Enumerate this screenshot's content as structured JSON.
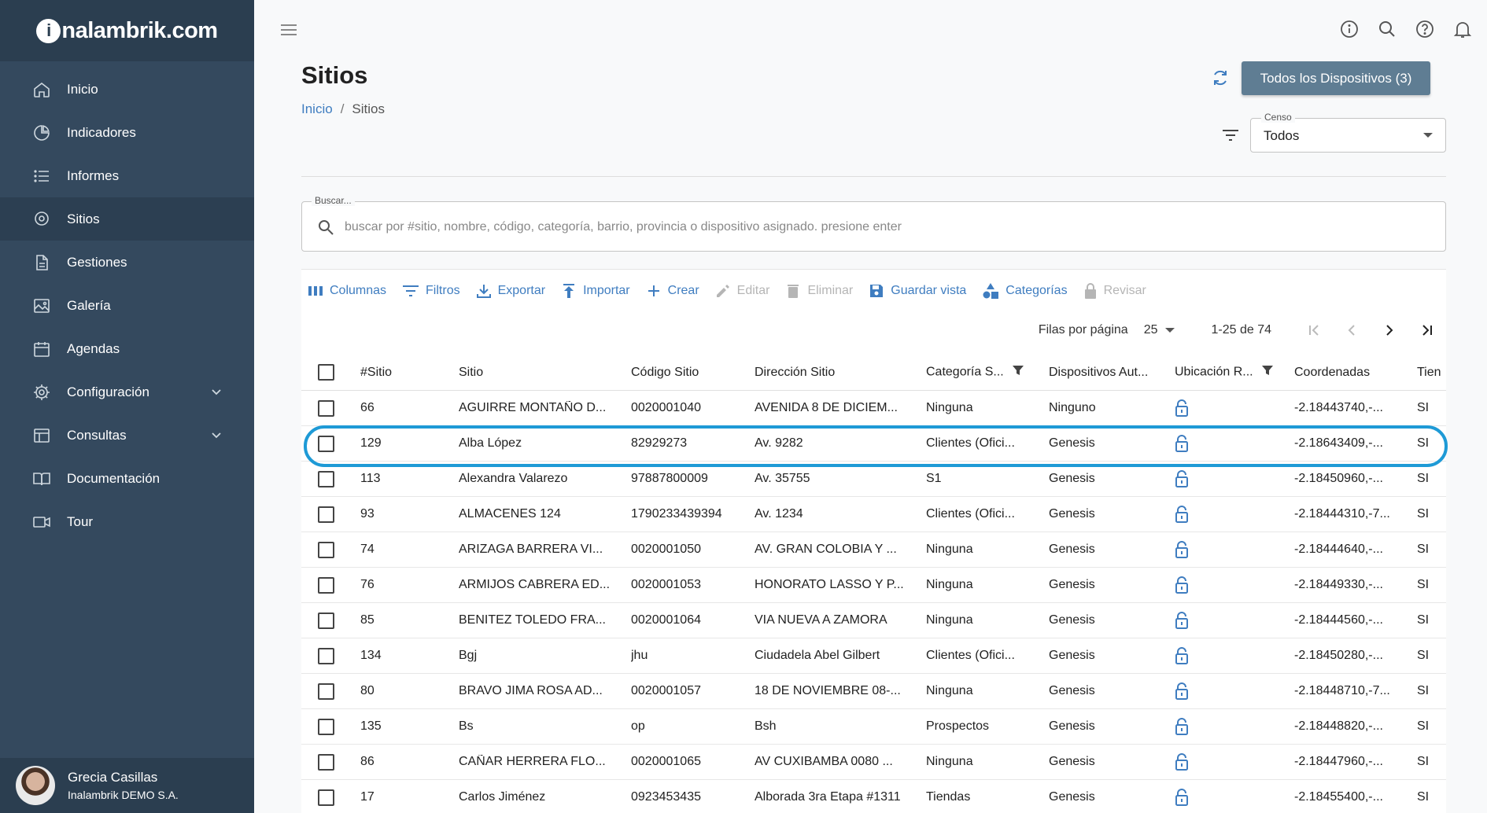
{
  "app": {
    "logo_letter": "i",
    "logo_text": "nalambrik.com"
  },
  "sidebar": {
    "items": [
      {
        "label": "Inicio",
        "icon": "home-icon"
      },
      {
        "label": "Indicadores",
        "icon": "pie-chart-icon"
      },
      {
        "label": "Informes",
        "icon": "list-icon"
      },
      {
        "label": "Sitios",
        "icon": "location-pin-icon",
        "active": true
      },
      {
        "label": "Gestiones",
        "icon": "document-icon"
      },
      {
        "label": "Galería",
        "icon": "image-icon"
      },
      {
        "label": "Agendas",
        "icon": "calendar-icon"
      },
      {
        "label": "Configuración",
        "icon": "gear-icon",
        "expandable": true
      },
      {
        "label": "Consultas",
        "icon": "table-icon",
        "expandable": true
      },
      {
        "label": "Documentación",
        "icon": "book-icon"
      },
      {
        "label": "Tour",
        "icon": "video-icon"
      }
    ],
    "user": {
      "name": "Grecia Casillas",
      "org": "Inalambrik DEMO S.A."
    }
  },
  "header": {
    "icons": [
      "info-icon",
      "search-icon",
      "help-icon",
      "bell-icon"
    ]
  },
  "page": {
    "title": "Sitios",
    "breadcrumb": {
      "home": "Inicio",
      "separator": "/",
      "current": "Sitios"
    },
    "all_devices_button": "Todos los Dispositivos (3)",
    "censo": {
      "label": "Censo",
      "value": "Todos"
    },
    "search": {
      "label": "Buscar...",
      "placeholder": "buscar por #sitio, nombre, código, categoría, barrio, provincia o dispositivo asignado. presione enter"
    }
  },
  "toolbar": {
    "columns": "Columnas",
    "filters": "Filtros",
    "export": "Exportar",
    "import": "Importar",
    "create": "Crear",
    "edit": "Editar",
    "delete": "Eliminar",
    "save_view": "Guardar vista",
    "categories": "Categorías",
    "review": "Revisar"
  },
  "pagination": {
    "rows_per_page_label": "Filas por página",
    "rows_per_page": "25",
    "range": "1-25 de 74"
  },
  "table": {
    "columns": [
      "#Sitio",
      "Sitio",
      "Código Sitio",
      "Dirección Sitio",
      "Categoría S...",
      "Dispositivos Aut...",
      "Ubicación R...",
      "Coordenadas",
      "Tien"
    ],
    "rows": [
      {
        "num": "66",
        "site": "AGUIRRE MONTAÑO D...",
        "code": "0020001040",
        "dir": "AVENIDA 8 DE DICIEM...",
        "cat": "Ninguna",
        "dev": "Ninguno",
        "coord": "-2.18443740,-...",
        "tien": "SI"
      },
      {
        "num": "129",
        "site": "Alba López",
        "code": "82929273",
        "dir": "Av. 9282",
        "cat": "Clientes (Ofici...",
        "dev": "Genesis",
        "coord": "-2.18643409,-...",
        "tien": "SI"
      },
      {
        "num": "113",
        "site": "Alexandra Valarezo",
        "code": "97887800009",
        "dir": "Av. 35755",
        "cat": "S1",
        "dev": "Genesis",
        "coord": "-2.18450960,-...",
        "tien": "SI"
      },
      {
        "num": "93",
        "site": "ALMACENES 124",
        "code": "1790233439394",
        "dir": "Av. 1234",
        "cat": "Clientes (Ofici...",
        "dev": "Genesis",
        "coord": "-2.18444310,-7...",
        "tien": "SI"
      },
      {
        "num": "74",
        "site": "ARIZAGA BARRERA VI...",
        "code": "0020001050",
        "dir": "AV. GRAN COLOBIA Y ...",
        "cat": "Ninguna",
        "dev": "Genesis",
        "coord": "-2.18444640,-...",
        "tien": "SI"
      },
      {
        "num": "76",
        "site": "ARMIJOS CABRERA ED...",
        "code": "0020001053",
        "dir": "HONORATO LASSO Y P...",
        "cat": "Ninguna",
        "dev": "Genesis",
        "coord": "-2.18449330,-...",
        "tien": "SI"
      },
      {
        "num": "85",
        "site": "BENITEZ TOLEDO FRA...",
        "code": "0020001064",
        "dir": "VIA NUEVA A ZAMORA",
        "cat": "Ninguna",
        "dev": "Genesis",
        "coord": "-2.18444560,-...",
        "tien": "SI"
      },
      {
        "num": "134",
        "site": "Bgj",
        "code": "jhu",
        "dir": "Ciudadela Abel Gilbert",
        "cat": "Clientes (Ofici...",
        "dev": "Genesis",
        "coord": "-2.18450280,-...",
        "tien": "SI"
      },
      {
        "num": "80",
        "site": "BRAVO JIMA ROSA AD...",
        "code": "0020001057",
        "dir": "18 DE NOVIEMBRE 08-...",
        "cat": "Ninguna",
        "dev": "Genesis",
        "coord": "-2.18448710,-7...",
        "tien": "SI"
      },
      {
        "num": "135",
        "site": "Bs",
        "code": "op",
        "dir": "Bsh",
        "cat": "Prospectos",
        "dev": "Genesis",
        "coord": "-2.18448820,-...",
        "tien": "SI"
      },
      {
        "num": "86",
        "site": "CAÑAR HERRERA FLO...",
        "code": "0020001065",
        "dir": "AV CUXIBAMBA 0080 ...",
        "cat": "Ninguna",
        "dev": "Genesis",
        "coord": "-2.18447960,-...",
        "tien": "SI"
      },
      {
        "num": "17",
        "site": "Carlos Jiménez",
        "code": "0923453435",
        "dir": "Alborada 3ra Etapa #1311",
        "cat": "Tiendas",
        "dev": "Genesis",
        "coord": "-2.18455400,-...",
        "tien": "SI"
      }
    ]
  },
  "colors": {
    "sidebar_bg": "#34495e",
    "accent": "#3f7dc0",
    "primary_button": "#5f7d93",
    "highlight": "#1e9ad6"
  }
}
